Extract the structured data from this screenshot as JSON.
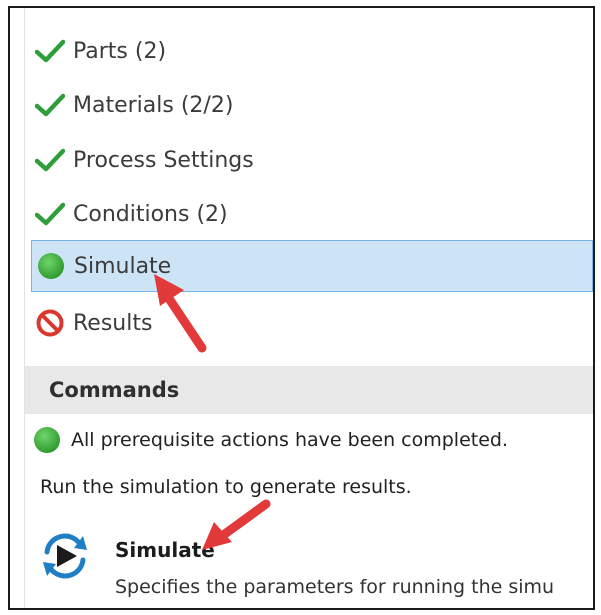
{
  "steps": [
    {
      "label": "Parts (2)",
      "icon": "checkmark-icon",
      "state": "complete"
    },
    {
      "label": "Materials (2/2)",
      "icon": "checkmark-icon",
      "state": "complete"
    },
    {
      "label": "Process Settings",
      "icon": "checkmark-icon",
      "state": "complete"
    },
    {
      "label": "Conditions (2)",
      "icon": "checkmark-icon",
      "state": "complete"
    },
    {
      "label": "Simulate",
      "icon": "green-dot-icon",
      "state": "ready",
      "selected": true
    },
    {
      "label": "Results",
      "icon": "prohibited-icon",
      "state": "blocked"
    }
  ],
  "commands": {
    "header": "Commands",
    "status_text": "All prerequisite actions have been completed.",
    "info_text": "Run the simulation to generate results.",
    "items": [
      {
        "title": "Simulate",
        "description": "Specifies the parameters for running the simu",
        "icon": "simulate-run-icon"
      }
    ]
  },
  "colors": {
    "check_green": "#2e9e3a",
    "ready_green": "#3caa3c",
    "blocked_red": "#d9382c",
    "selection_bg": "#cde4f7",
    "selection_border": "#79b4e6",
    "annotation_arrow": "#e23a3a"
  }
}
